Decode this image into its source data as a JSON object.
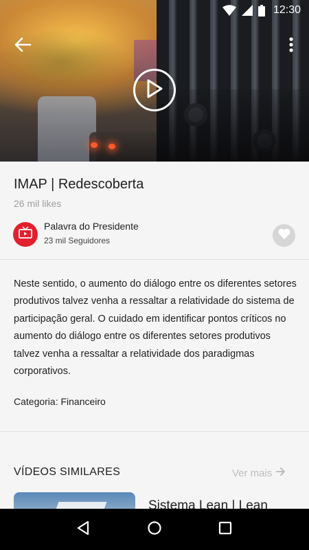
{
  "status_bar": {
    "time": "12:30"
  },
  "video": {
    "title": "IMAP | Redescoberta",
    "likes": "26 mil likes"
  },
  "channel": {
    "name": "Palavra do Presidente",
    "followers": "23 mil Seguidores"
  },
  "description": "Neste sentido, o aumento do diálogo entre os diferentes setores produtivos talvez venha a ressaltar a relatividade do sistema de participação geral. O cuidado em identificar pontos críticos no aumento do diálogo entre os diferentes setores produtivos talvez venha a ressaltar a relatividade dos paradigmas corporativos.",
  "category": "Categoria: Financeiro",
  "similar": {
    "heading": "VÍDEOS SIMILARES",
    "see_more": "Ver mais",
    "items": [
      {
        "title": "Sistema Lean | Lean"
      }
    ]
  },
  "colors": {
    "accent": "#e3202e",
    "background": "#f5f5f5",
    "muted_text": "#9e9e9e"
  },
  "icons": {
    "back": "arrow-back-icon",
    "more": "more-vert-icon",
    "play": "play-icon",
    "channel": "tv-icon",
    "like": "heart-icon",
    "see_more": "arrow-forward-icon",
    "nav_back": "nav-back-icon",
    "nav_home": "nav-home-icon",
    "nav_recents": "nav-recents-icon"
  }
}
